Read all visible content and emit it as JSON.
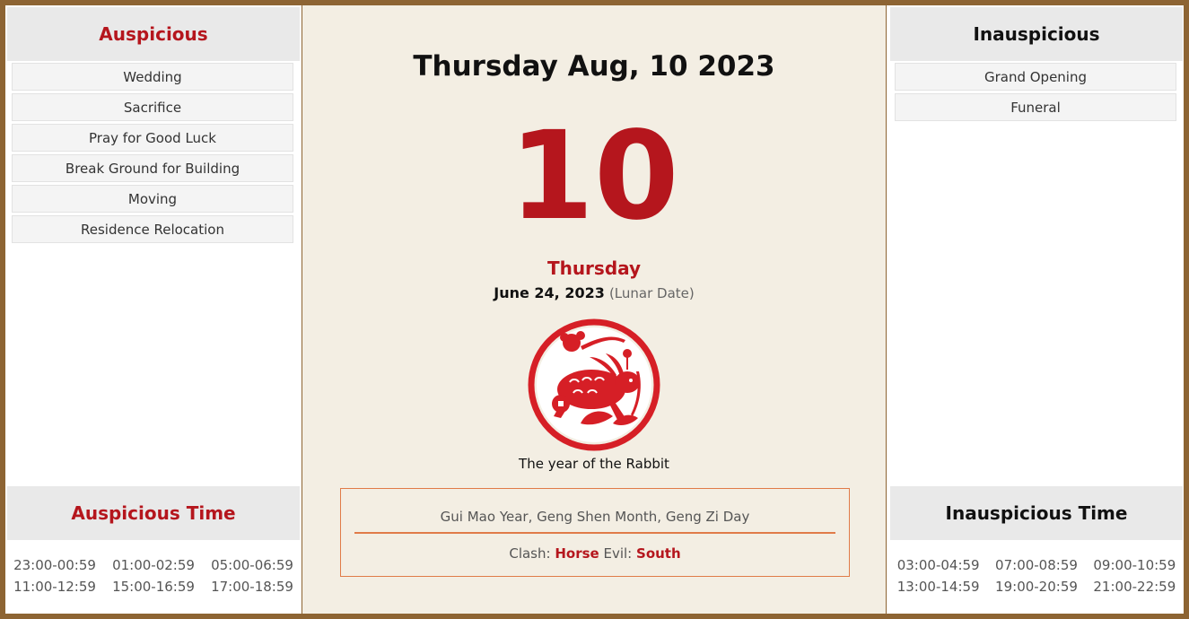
{
  "auspicious": {
    "title": "Auspicious",
    "items": [
      "Wedding",
      "Sacrifice",
      "Pray for Good Luck",
      "Break Ground for Building",
      "Moving",
      "Residence Relocation"
    ]
  },
  "auspicious_time": {
    "title": "Auspicious Time",
    "times": [
      "23:00-00:59",
      "01:00-02:59",
      "05:00-06:59",
      "11:00-12:59",
      "15:00-16:59",
      "17:00-18:59"
    ]
  },
  "inauspicious": {
    "title": "Inauspicious",
    "items": [
      "Grand Opening",
      "Funeral"
    ]
  },
  "inauspicious_time": {
    "title": "Inauspicious Time",
    "times": [
      "03:00-04:59",
      "07:00-08:59",
      "09:00-10:59",
      "13:00-14:59",
      "19:00-20:59",
      "21:00-22:59"
    ]
  },
  "main": {
    "date_title": "Thursday Aug, 10 2023",
    "day_number": "10",
    "weekday": "Thursday",
    "lunar_date": "June 24, 2023",
    "lunar_note": "(Lunar Date)",
    "zodiac_icon": "rabbit-papercut-icon",
    "zodiac_caption": "The year of the Rabbit",
    "ganzhi": "Gui Mao Year, Geng Shen Month, Geng Zi Day",
    "clash_label": "Clash:",
    "clash_value": "Horse",
    "evil_label": "Evil:",
    "evil_value": "South"
  },
  "colors": {
    "accent_red": "#b5161d",
    "frame_brown": "#8d6433",
    "box_orange": "#e07b48",
    "paper": "#f3eee3"
  }
}
